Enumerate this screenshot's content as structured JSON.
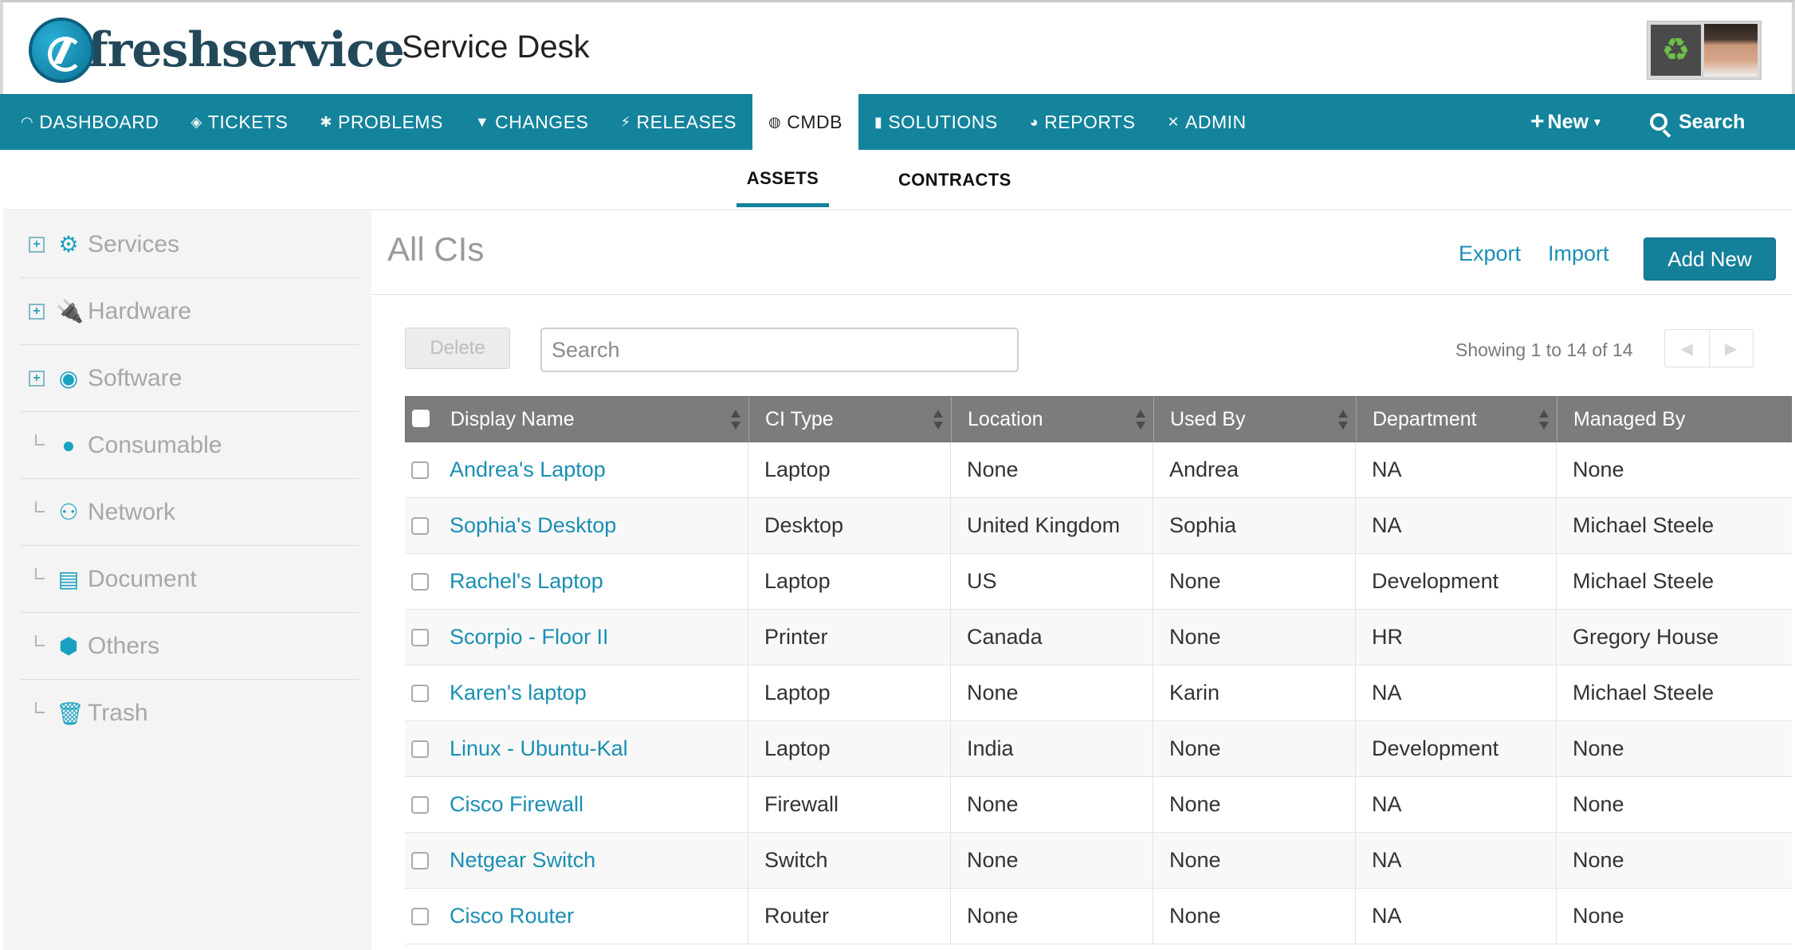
{
  "header": {
    "logo_text": "freshservice",
    "app_title": "Service Desk"
  },
  "nav": {
    "items": [
      {
        "label": "DASHBOARD",
        "icon": "dashboard-icon"
      },
      {
        "label": "TICKETS",
        "icon": "ticket-icon"
      },
      {
        "label": "PROBLEMS",
        "icon": "bug-icon"
      },
      {
        "label": "CHANGES",
        "icon": "shield-icon"
      },
      {
        "label": "RELEASES",
        "icon": "rocket-icon"
      },
      {
        "label": "CMDB",
        "icon": "cube-icon",
        "active": true
      },
      {
        "label": "SOLUTIONS",
        "icon": "book-icon"
      },
      {
        "label": "REPORTS",
        "icon": "pie-chart-icon"
      },
      {
        "label": "ADMIN",
        "icon": "tools-icon"
      }
    ],
    "new_label": "New",
    "search_label": "Search"
  },
  "subnav": {
    "tabs": [
      {
        "label": "ASSETS",
        "active": true
      },
      {
        "label": "CONTRACTS",
        "active": false
      }
    ]
  },
  "sidebar": {
    "items": [
      {
        "label": "Services",
        "icon": "services-icon",
        "expandable": true
      },
      {
        "label": "Hardware",
        "icon": "plug-icon",
        "expandable": true
      },
      {
        "label": "Software",
        "icon": "disc-icon",
        "expandable": true
      },
      {
        "label": "Consumable",
        "icon": "mouse-icon",
        "expandable": false
      },
      {
        "label": "Network",
        "icon": "network-icon",
        "expandable": false
      },
      {
        "label": "Document",
        "icon": "document-icon",
        "expandable": false
      },
      {
        "label": "Others",
        "icon": "box-icon",
        "expandable": false
      },
      {
        "label": "Trash",
        "icon": "trash-icon",
        "expandable": false
      }
    ]
  },
  "main": {
    "title": "All CIs",
    "export_label": "Export",
    "import_label": "Import",
    "add_new_label": "Add New",
    "delete_label": "Delete",
    "search_placeholder": "Search",
    "showing_text": "Showing 1 to 14 of 14"
  },
  "table": {
    "columns": [
      "Display Name",
      "CI Type",
      "Location",
      "Used By",
      "Department",
      "Managed By"
    ],
    "rows": [
      [
        "Andrea's Laptop",
        "Laptop",
        "None",
        "Andrea",
        "NA",
        "None"
      ],
      [
        "Sophia's Desktop",
        "Desktop",
        "United Kingdom",
        "Sophia",
        "NA",
        "Michael Steele"
      ],
      [
        "Rachel's Laptop",
        "Laptop",
        "US",
        "None",
        "Development",
        "Michael Steele"
      ],
      [
        "Scorpio - Floor II",
        "Printer",
        "Canada",
        "None",
        "HR",
        "Gregory House"
      ],
      [
        "Karen's laptop",
        "Laptop",
        "None",
        "Karin",
        "NA",
        "Michael Steele"
      ],
      [
        "Linux - Ubuntu-Kal",
        "Laptop",
        "India",
        "None",
        "Development",
        "None"
      ],
      [
        "Cisco Firewall",
        "Firewall",
        "None",
        "None",
        "NA",
        "None"
      ],
      [
        "Netgear Switch",
        "Switch",
        "None",
        "None",
        "NA",
        "None"
      ],
      [
        "Cisco Router",
        "Router",
        "None",
        "None",
        "NA",
        "None"
      ]
    ]
  },
  "colors": {
    "brand": "#14839c",
    "link": "#1a8fb3",
    "sidebar_icon": "#1aa1c1",
    "table_header": "#7c7c7c"
  }
}
